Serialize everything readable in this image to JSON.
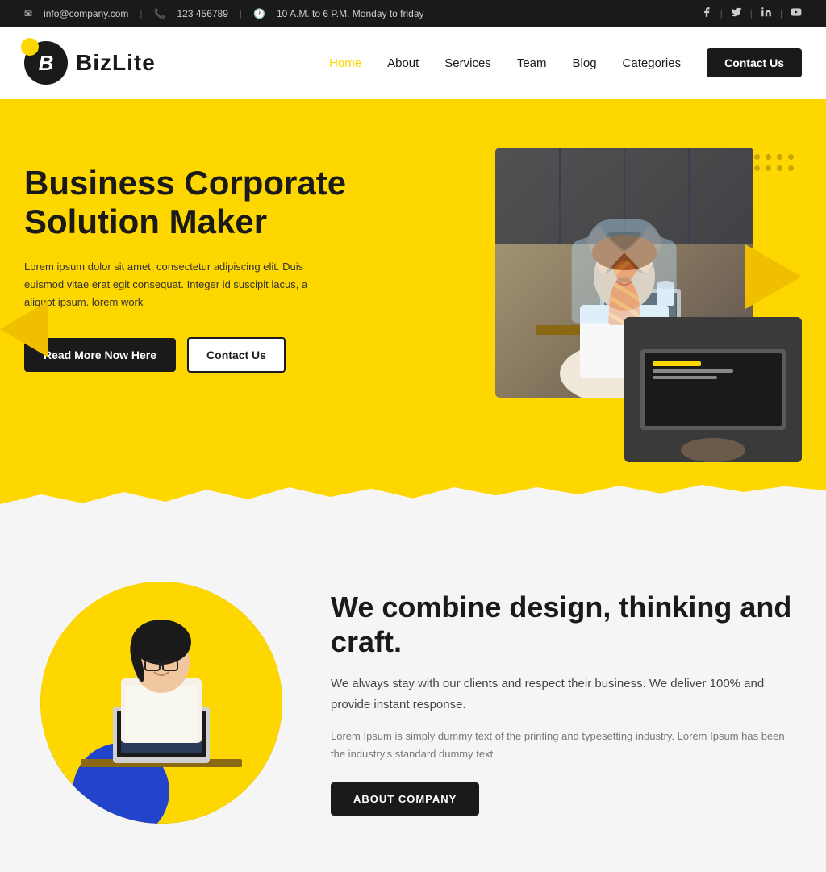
{
  "topbar": {
    "email": "info@company.com",
    "phone": "123 456789",
    "hours": "10 A.M. to 6 P.M. Monday to friday",
    "social": {
      "facebook": "f",
      "twitter": "t",
      "linkedin": "in",
      "youtube": "yt"
    }
  },
  "navbar": {
    "brand": "BizLite",
    "links": [
      {
        "label": "Home",
        "active": false
      },
      {
        "label": "About",
        "active": false
      },
      {
        "label": "Services",
        "active": false
      },
      {
        "label": "Team",
        "active": false
      },
      {
        "label": "Blog",
        "active": false
      },
      {
        "label": "Categories",
        "active": false
      }
    ],
    "cta": "Contact Us"
  },
  "hero": {
    "title": "Business Corporate Solution Maker",
    "description": "Lorem ipsum dolor sit amet, consectetur adipiscing elit. Duis euismod vitae erat egit consequat. Integer id suscipit lacus, a aliquot ipsum. lorem work",
    "btn_primary": "Read More Now Here",
    "btn_secondary": "Contact Us"
  },
  "section2": {
    "title": "We combine design, thinking and craft.",
    "subtitle": "We always stay with our clients and respect their business. We deliver 100% and provide instant response.",
    "lorem": "Lorem Ipsum is simply dummy text of the printing and typesetting industry. Lorem Ipsum has been the industry's standard dummy text",
    "btn_label": "ABOUT COMPANY"
  }
}
